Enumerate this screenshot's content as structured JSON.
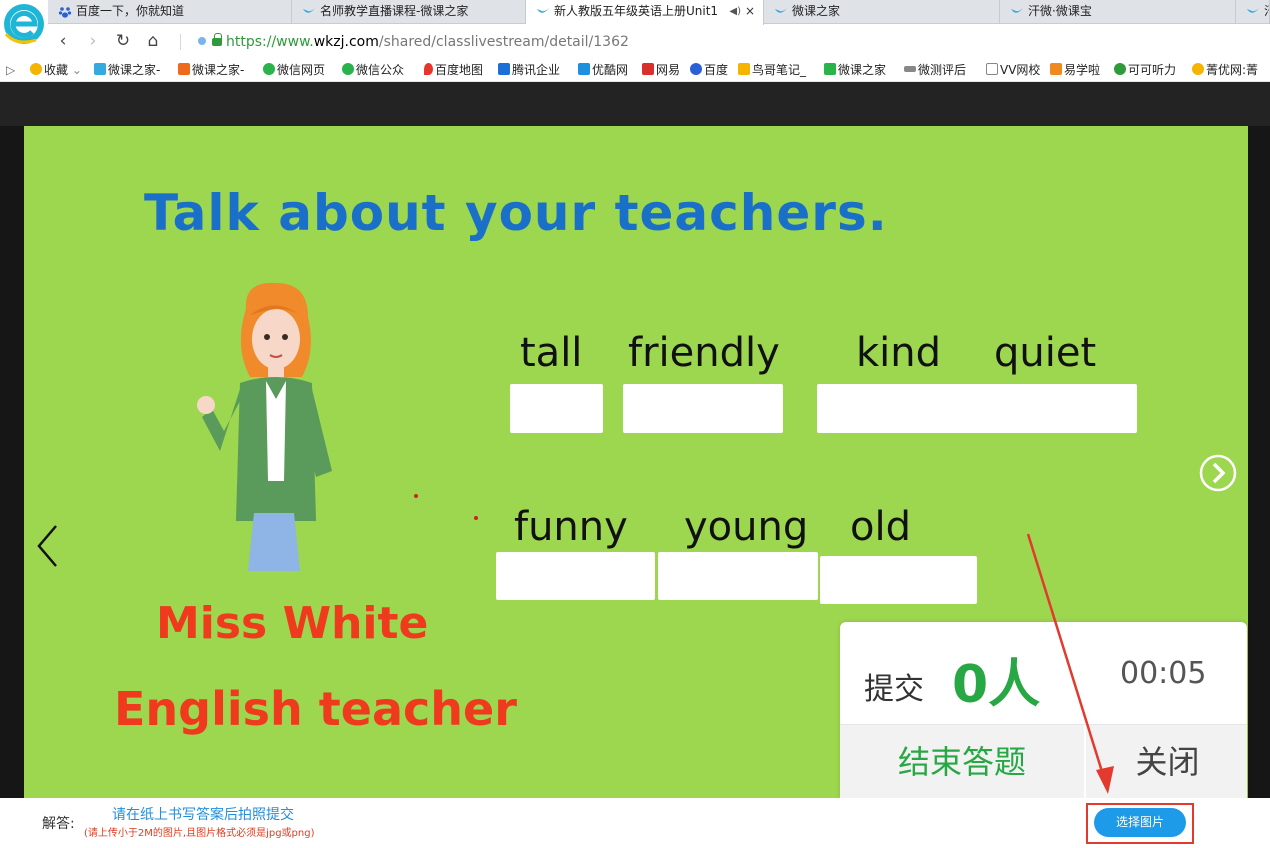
{
  "browser": {
    "tabs": [
      {
        "label": "百度一下，你就知道",
        "icon": "baidu-paw-icon"
      },
      {
        "label": "名师教学直播课程-微课之家",
        "icon": "wkzj-bird-icon"
      },
      {
        "label": "新人教版五年级英语上册Unit1",
        "icon": "wkzj-bird-icon",
        "active": true
      },
      {
        "label": "微课之家",
        "icon": "wkzj-bird-icon"
      },
      {
        "label": "汗微·微课宝",
        "icon": "wkzj-bird-icon"
      },
      {
        "label": "汗",
        "icon": "wkzj-bird-icon"
      }
    ],
    "tab_close_glyph": "×",
    "tab_audio_glyph": "◀)",
    "nav": {
      "back": "‹",
      "forward": "›",
      "refresh": "↻",
      "home": "⌂"
    },
    "url": {
      "scheme": "https://www.",
      "domain": "wkzj.com",
      "path": "/shared/classlivestream/detail/1362"
    },
    "bookmarks": [
      {
        "label": "收藏",
        "color": "#f5b400"
      },
      {
        "label": "微课之家-",
        "color": "#36a9e1"
      },
      {
        "label": "微课之家-",
        "color": "#f06a1e"
      },
      {
        "label": "微信网页",
        "color": "#29b34a"
      },
      {
        "label": "微信公众",
        "color": "#29b34a"
      },
      {
        "label": "百度地图",
        "color": "#e8352c"
      },
      {
        "label": "腾讯企业",
        "color": "#1b6fd6"
      },
      {
        "label": "优酷网",
        "color": "#1f8fe0"
      },
      {
        "label": "网易",
        "color": "#d9302c"
      },
      {
        "label": "百度",
        "color": "#2a5fd6"
      },
      {
        "label": "鸟哥笔记_",
        "color": "#f5b400"
      },
      {
        "label": "微课之家",
        "color": "#29b34a"
      },
      {
        "label": "微测评后",
        "color": "#888888"
      },
      {
        "label": "VV网校",
        "color": "#777777"
      },
      {
        "label": "易学啦",
        "color": "#f08a1e"
      },
      {
        "label": "可可听力",
        "color": "#2e9a3a"
      },
      {
        "label": "菁优网:菁",
        "color": "#f5b400"
      }
    ],
    "bookmarks_toggle": "▷",
    "bookmarks_caret": "⌄"
  },
  "slide": {
    "title": "Talk about your teachers.",
    "words_row1": [
      "tall",
      "friendly",
      "kind",
      "quiet"
    ],
    "words_row2": [
      "funny",
      "young",
      "old"
    ],
    "teacher_name": "Miss White",
    "teacher_role": "English teacher"
  },
  "popup": {
    "submit_label": "提交",
    "count": "0人",
    "timer": "00:05",
    "end_button": "结束答题",
    "close_button": "关闭"
  },
  "answer": {
    "label": "解答:",
    "hint": "请在纸上书写答案后拍照提交",
    "note": "(请上传小于2M的图片,且图片格式必须是jpg或png)",
    "choose_button": "选择图片"
  },
  "colors": {
    "slide_bg": "#9dd64f",
    "title_blue": "#1a6fc9",
    "name_red": "#f03a1e",
    "accent_green": "#27a844",
    "button_blue": "#1e9be8",
    "highlight_red": "#e33a2f"
  }
}
